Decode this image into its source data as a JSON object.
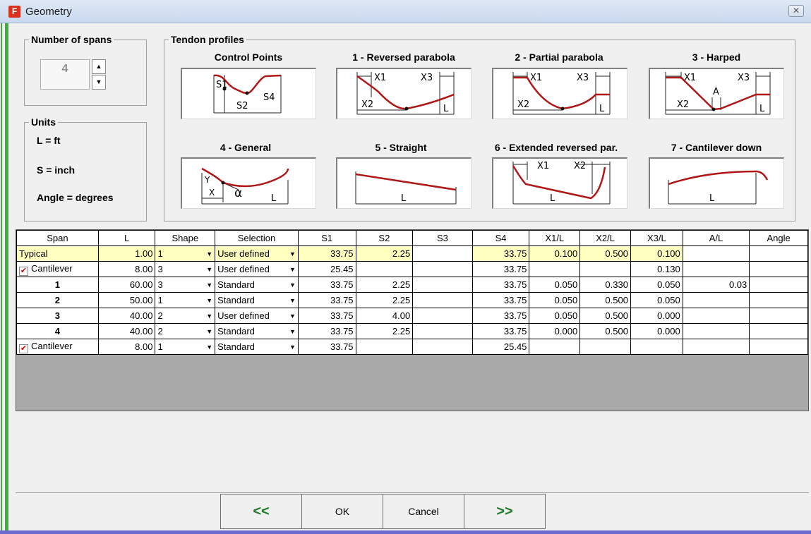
{
  "window": {
    "title": "Geometry",
    "app_icon": "F",
    "close_glyph": "✕"
  },
  "spans_group": {
    "legend": "Number of spans",
    "value": "4",
    "up_glyph": "▲",
    "down_glyph": "▼"
  },
  "units_group": {
    "legend": "Units",
    "lines": [
      "L = ft",
      "S = inch",
      "Angle = degrees"
    ]
  },
  "tendon_group": {
    "legend": "Tendon profiles",
    "profiles": [
      {
        "label": "Control Points",
        "marks": [
          "S1",
          "S2",
          "S4"
        ]
      },
      {
        "label": "1 - Reversed parabola",
        "marks": [
          "X1",
          "X3",
          "X2",
          "L"
        ]
      },
      {
        "label": "2 - Partial parabola",
        "marks": [
          "X1",
          "X3",
          "X2",
          "L"
        ]
      },
      {
        "label": "3 - Harped",
        "marks": [
          "X1",
          "X3",
          "A",
          "X2",
          "L"
        ]
      },
      {
        "label": "4 - General",
        "marks": [
          "Y",
          "X",
          "α",
          "L"
        ]
      },
      {
        "label": "5 - Straight",
        "marks": [
          "L"
        ]
      },
      {
        "label": "6 - Extended reversed par.",
        "marks": [
          "X1",
          "X2",
          "L"
        ]
      },
      {
        "label": "7 - Cantilever down",
        "marks": [
          "L"
        ]
      }
    ]
  },
  "grid": {
    "headers": [
      "Span",
      "L",
      "Shape",
      "Selection",
      "S1",
      "S2",
      "S3",
      "S4",
      "X1/L",
      "X2/L",
      "X3/L",
      "A/L",
      "Angle"
    ],
    "rows": [
      {
        "span": "Typical",
        "checked": false,
        "L": "1.00",
        "shape": "1",
        "selection": "User defined",
        "S1": "33.75",
        "S2": "2.25",
        "S3": "",
        "S4": "33.75",
        "X1L": "0.100",
        "X2L": "0.500",
        "X3L": "0.100",
        "AL": "",
        "angle": ""
      },
      {
        "span": "Cantilever",
        "checked": true,
        "L": "8.00",
        "shape": "3",
        "selection": "User defined",
        "S1": "25.45",
        "S2": "",
        "S3": "",
        "S4": "33.75",
        "X1L": "",
        "X2L": "",
        "X3L": "0.130",
        "AL": "",
        "angle": ""
      },
      {
        "span": "1",
        "checked": false,
        "L": "60.00",
        "shape": "3",
        "selection": "Standard",
        "S1": "33.75",
        "S2": "2.25",
        "S3": "",
        "S4": "33.75",
        "X1L": "0.050",
        "X2L": "0.330",
        "X3L": "0.050",
        "AL": "0.03",
        "angle": ""
      },
      {
        "span": "2",
        "checked": false,
        "L": "50.00",
        "shape": "1",
        "selection": "Standard",
        "S1": "33.75",
        "S2": "2.25",
        "S3": "",
        "S4": "33.75",
        "X1L": "0.050",
        "X2L": "0.500",
        "X3L": "0.050",
        "AL": "",
        "angle": ""
      },
      {
        "span": "3",
        "checked": false,
        "L": "40.00",
        "shape": "2",
        "selection": "User defined",
        "S1": "33.75",
        "S2": "4.00",
        "S3": "",
        "S4": "33.75",
        "X1L": "0.050",
        "X2L": "0.500",
        "X3L": "0.000",
        "AL": "",
        "angle": ""
      },
      {
        "span": "4",
        "checked": false,
        "L": "40.00",
        "shape": "2",
        "selection": "Standard",
        "S1": "33.75",
        "S2": "2.25",
        "S3": "",
        "S4": "33.75",
        "X1L": "0.000",
        "X2L": "0.500",
        "X3L": "0.000",
        "AL": "",
        "angle": ""
      },
      {
        "span": "Cantilever",
        "checked": true,
        "L": "8.00",
        "shape": "1",
        "selection": "Standard",
        "S1": "33.75",
        "S2": "",
        "S3": "",
        "S4": "25.45",
        "X1L": "",
        "X2L": "",
        "X3L": "",
        "AL": "",
        "angle": ""
      }
    ],
    "combo_arrow": "▼",
    "check_glyph": "✔"
  },
  "buttons": {
    "prev": "<<",
    "ok": "OK",
    "cancel": "Cancel",
    "next": ">>"
  },
  "colors": {
    "tendon": "#b01818",
    "frame_green": "#3fae3f",
    "highlight": "#ffffc0"
  }
}
